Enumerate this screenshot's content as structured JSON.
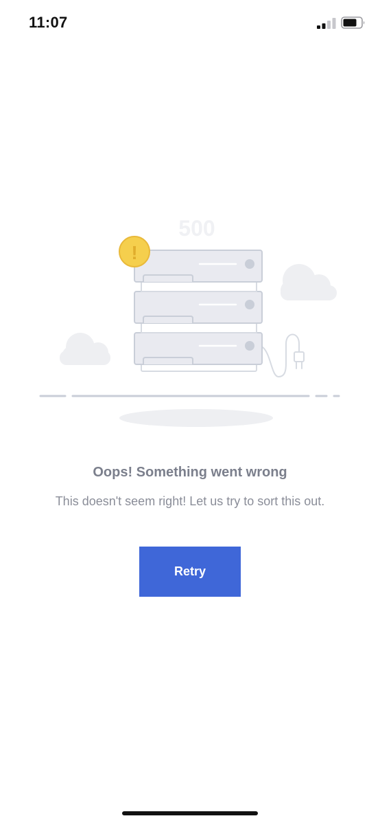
{
  "status_bar": {
    "time": "11:07",
    "signal_icon": "cellular-signal-icon",
    "battery_icon": "battery-icon"
  },
  "illustration": {
    "code_text": "500",
    "warning_symbol": "!",
    "icons": [
      "server-stack-icon",
      "warning-icon",
      "cloud-icon",
      "power-plug-icon"
    ],
    "colors": {
      "warning": "#f5cf4d",
      "server_fill": "#e9eaf0",
      "server_stroke": "#c9ced8",
      "cloud": "#eeeff2"
    }
  },
  "error": {
    "title": "Oops! Something went wrong",
    "message": "This doesn't seem right! Let us try to sort this out."
  },
  "retry_button": {
    "label": "Retry",
    "color": "#3f67d8"
  }
}
